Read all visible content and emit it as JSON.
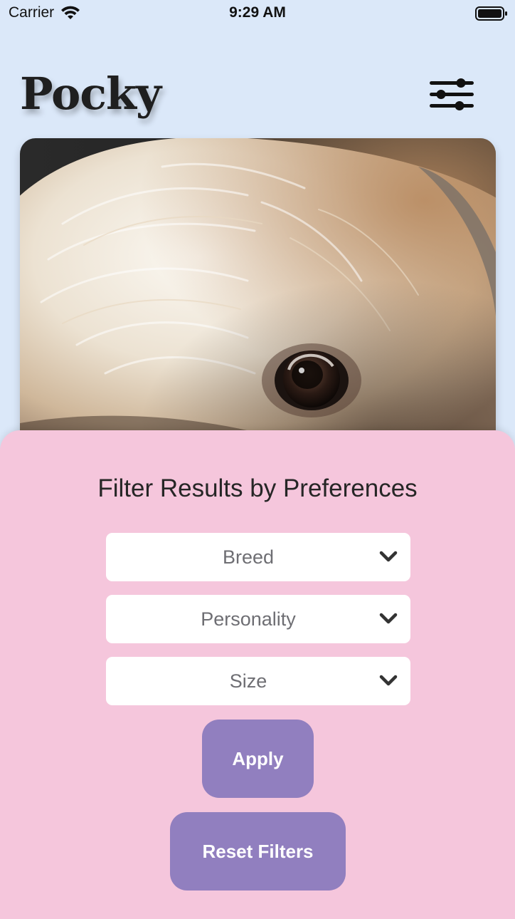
{
  "status_bar": {
    "carrier": "Carrier",
    "time": "9:29 AM"
  },
  "header": {
    "app_title": "Pocky",
    "filter_icon": "sliders-icon"
  },
  "hero": {
    "image_icon": "dog-photo"
  },
  "filter_sheet": {
    "title": "Filter Results by Preferences",
    "dropdowns": [
      {
        "label": "Breed",
        "icon": "chevron-down-icon"
      },
      {
        "label": "Personality",
        "icon": "chevron-down-icon"
      },
      {
        "label": "Size",
        "icon": "chevron-down-icon"
      }
    ],
    "apply_label": "Apply",
    "reset_label": "Reset Filters"
  },
  "colors": {
    "background": "#dbe8f9",
    "sheet": "#f5c6dc",
    "button": "#917fbf",
    "dropdown_text": "#6e6e73"
  }
}
